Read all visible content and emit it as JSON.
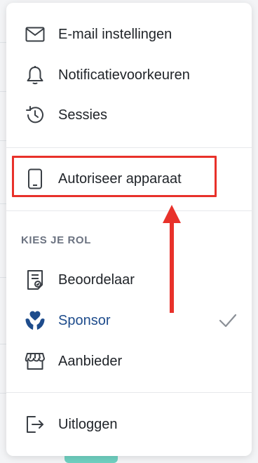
{
  "menu": {
    "items_top": [
      {
        "label": "E-mail instellingen",
        "icon": "mail-icon"
      },
      {
        "label": "Notificatievoorkeuren",
        "icon": "bell-icon"
      },
      {
        "label": "Sessies",
        "icon": "history-icon"
      }
    ],
    "authorize": {
      "label": "Autoriseer apparaat",
      "icon": "mobile-icon"
    },
    "roles": {
      "title": "KIES JE ROL",
      "items": [
        {
          "label": "Beoordelaar",
          "icon": "review-document-icon",
          "active": false
        },
        {
          "label": "Sponsor",
          "icon": "heart-hands-icon",
          "active": true
        },
        {
          "label": "Aanbieder",
          "icon": "storefront-icon",
          "active": false
        }
      ]
    },
    "logout": {
      "label": "Uitloggen",
      "icon": "logout-icon"
    }
  },
  "colors": {
    "text": "#1f2328",
    "active": "#1e4c8c",
    "muted": "#6b7280",
    "annotation_red": "#e8312a"
  }
}
